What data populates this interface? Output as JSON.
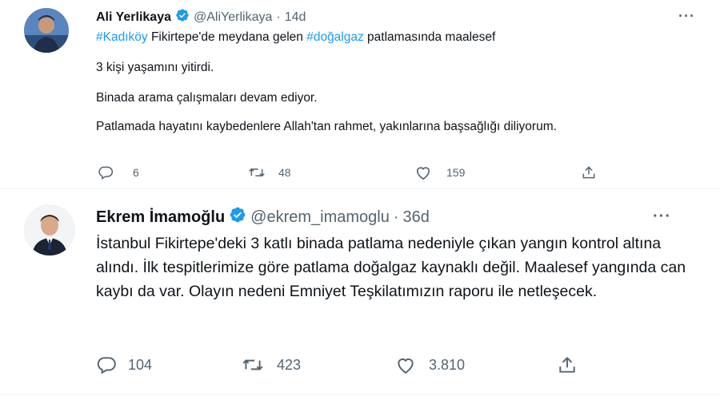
{
  "tweets": [
    {
      "author_name": "Ali Yerlikaya",
      "handle": "@AliYerlikaya",
      "separator": "·",
      "time": "14d",
      "more": "···",
      "text": {
        "line1_tag1": "#Kadıköy",
        "line1_mid": " Fikirtepe'de meydana gelen ",
        "line1_tag2": "#doğalgaz",
        "line1_end": " patlamasında maalesef",
        "p2": "3 kişi yaşamını yitirdi.",
        "p3": "Binada arama çalışmaları devam ediyor.",
        "p4": "Patlamada hayatını kaybedenlere Allah'tan rahmet, yakınlarına başsağlığı diliyorum."
      },
      "replies": "6",
      "retweets": "48",
      "likes": "159"
    },
    {
      "author_name": "Ekrem İmamoğlu",
      "handle": "@ekrem_imamoglu",
      "separator": "·",
      "time": "36d",
      "more": "···",
      "text": "İstanbul Fikirtepe'deki 3 katlı binada patlama nedeniyle çıkan yangın kontrol altına alındı. İlk tespitlerimize göre patlama doğalgaz kaynaklı değil. Maalesef yangında can kaybı da var. Olayın nedeni Emniyet Teşkilatımızın raporu ile netleşecek.",
      "replies": "104",
      "retweets": "423",
      "likes": "3.810"
    }
  ],
  "colors": {
    "hashtag": "#1d9bf0",
    "verified": "#1d9bf0",
    "secondary_text": "#536471",
    "divider": "#eff3f4"
  },
  "icons": [
    "verified-badge-icon",
    "more-icon",
    "reply-icon",
    "retweet-icon",
    "like-icon",
    "share-icon"
  ]
}
